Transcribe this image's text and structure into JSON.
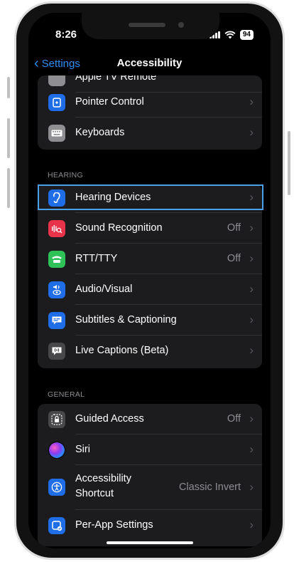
{
  "status_bar": {
    "time": "8:26",
    "battery": "94"
  },
  "nav": {
    "back_label": "Settings",
    "title": "Accessibility"
  },
  "group_top": {
    "partial_item": "Apple TV Remote",
    "items": [
      {
        "label": "Pointer Control",
        "icon": "pointer-control-icon",
        "color": "#1f6ee8"
      },
      {
        "label": "Keyboards",
        "icon": "keyboard-icon",
        "color": "#8e8e93"
      }
    ]
  },
  "hearing": {
    "header": "HEARING",
    "items": [
      {
        "label": "Hearing Devices",
        "value": "",
        "icon": "ear-icon",
        "color": "#1f6ee8"
      },
      {
        "label": "Sound Recognition",
        "value": "Off",
        "icon": "sound-recognition-icon",
        "color": "#e8344a"
      },
      {
        "label": "RTT/TTY",
        "value": "Off",
        "icon": "rtt-tty-icon",
        "color": "#30c158"
      },
      {
        "label": "Audio/Visual",
        "value": "",
        "icon": "audio-visual-icon",
        "color": "#1f6ee8"
      },
      {
        "label": "Subtitles & Captioning",
        "value": "",
        "icon": "subtitles-icon",
        "color": "#1f6ee8"
      },
      {
        "label": "Live Captions (Beta)",
        "value": "",
        "icon": "live-captions-icon",
        "color": "#48484a"
      }
    ]
  },
  "general": {
    "header": "GENERAL",
    "items": [
      {
        "label": "Guided Access",
        "value": "Off",
        "icon": "guided-access-icon",
        "color": "#48484a"
      },
      {
        "label": "Siri",
        "value": "",
        "icon": "siri-icon",
        "color": "#8a3cf0"
      },
      {
        "label_line1": "Accessibility",
        "label_line2": "Shortcut",
        "value": "Classic Invert",
        "icon": "accessibility-icon",
        "color": "#1f6ee8"
      },
      {
        "label": "Per-App Settings",
        "value": "",
        "icon": "per-app-settings-icon",
        "color": "#1f6ee8"
      }
    ]
  }
}
